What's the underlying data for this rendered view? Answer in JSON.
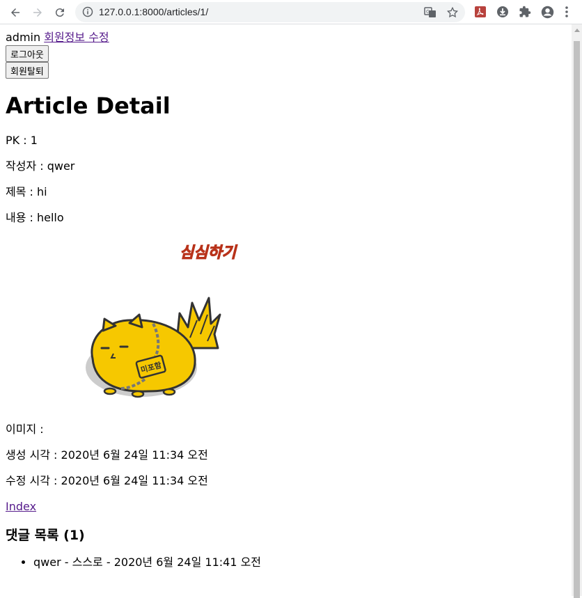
{
  "browser": {
    "url": "127.0.0.1:8000/articles/1/"
  },
  "header": {
    "username": "admin",
    "edit_profile_link": "회원정보 수정",
    "logout_button": "로그아웃",
    "withdraw_button": "회원탈퇴"
  },
  "article": {
    "heading": "Article Detail",
    "pk": "PK : 1",
    "author": "작성자 : qwer",
    "title": "제목 : hi",
    "content": "내용 : hello",
    "image_caption": "이미지 :",
    "image_logo_text": "심심하기",
    "image_badge_text": "미포함",
    "created": "생성 시각 : 2020년 6월 24일 11:34 오전",
    "updated": "수정 시각 : 2020년 6월 24일 11:34 오전",
    "index_link": "Index"
  },
  "comments": {
    "heading": "댓글 목록 (1)",
    "items": [
      {
        "text": "qwer - 스스로 - 2020년 6월 24일 11:41 오전"
      }
    ]
  }
}
